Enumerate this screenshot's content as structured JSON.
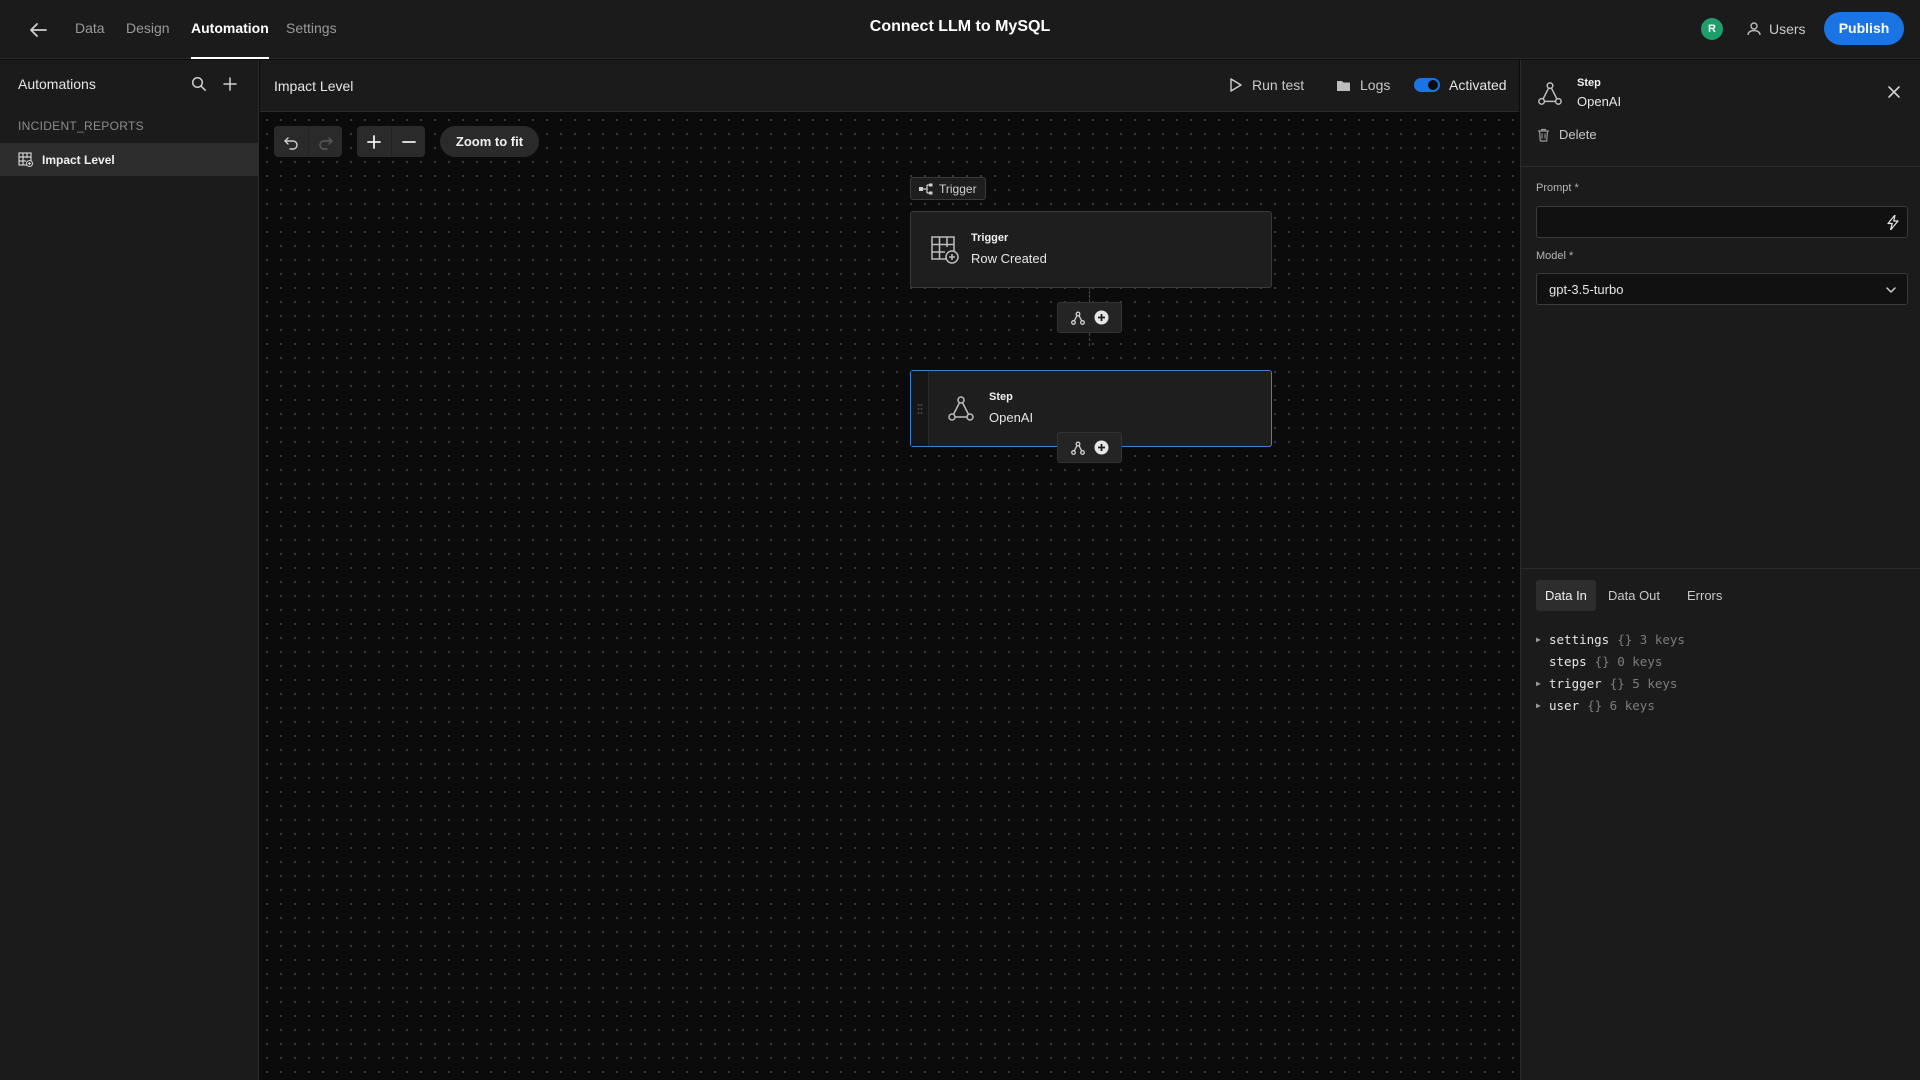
{
  "app": {
    "title": "Connect LLM to MySQL",
    "tabs": [
      {
        "label": "Data"
      },
      {
        "label": "Design"
      },
      {
        "label": "Automation"
      },
      {
        "label": "Settings"
      }
    ],
    "active_tab": "Automation",
    "avatar_initial": "R",
    "users_label": "Users",
    "publish_label": "Publish"
  },
  "sidebar": {
    "title": "Automations",
    "section": "INCIDENT_REPORTS",
    "items": [
      {
        "label": "Impact Level"
      }
    ]
  },
  "canvas": {
    "title": "Impact Level",
    "run_test_label": "Run test",
    "logs_label": "Logs",
    "activated_label": "Activated",
    "activated": true,
    "zoom_fit_label": "Zoom to fit",
    "trigger_tag": "Trigger",
    "trigger_node": {
      "kicker": "Trigger",
      "label": "Row Created"
    },
    "step_node": {
      "kicker": "Step",
      "label": "OpenAI"
    }
  },
  "panel": {
    "kicker": "Step",
    "name": "OpenAI",
    "delete_label": "Delete",
    "prompt_label": "Prompt *",
    "prompt_value": "",
    "model_label": "Model *",
    "model_value": "gpt-3.5-turbo",
    "tabs": [
      {
        "label": "Data In"
      },
      {
        "label": "Data Out"
      },
      {
        "label": "Errors"
      }
    ],
    "active_tab": "Data In",
    "tree": [
      {
        "key": "settings",
        "meta": "{} 3 keys",
        "expandable": true
      },
      {
        "key": "steps",
        "meta": "{} 0 keys",
        "expandable": false
      },
      {
        "key": "trigger",
        "meta": "{} 5 keys",
        "expandable": true
      },
      {
        "key": "user",
        "meta": "{} 6 keys",
        "expandable": true
      }
    ]
  },
  "colors": {
    "accent": "#1b74e4",
    "avatar": "#1f9d6a",
    "selected_border": "#3b82d6"
  }
}
